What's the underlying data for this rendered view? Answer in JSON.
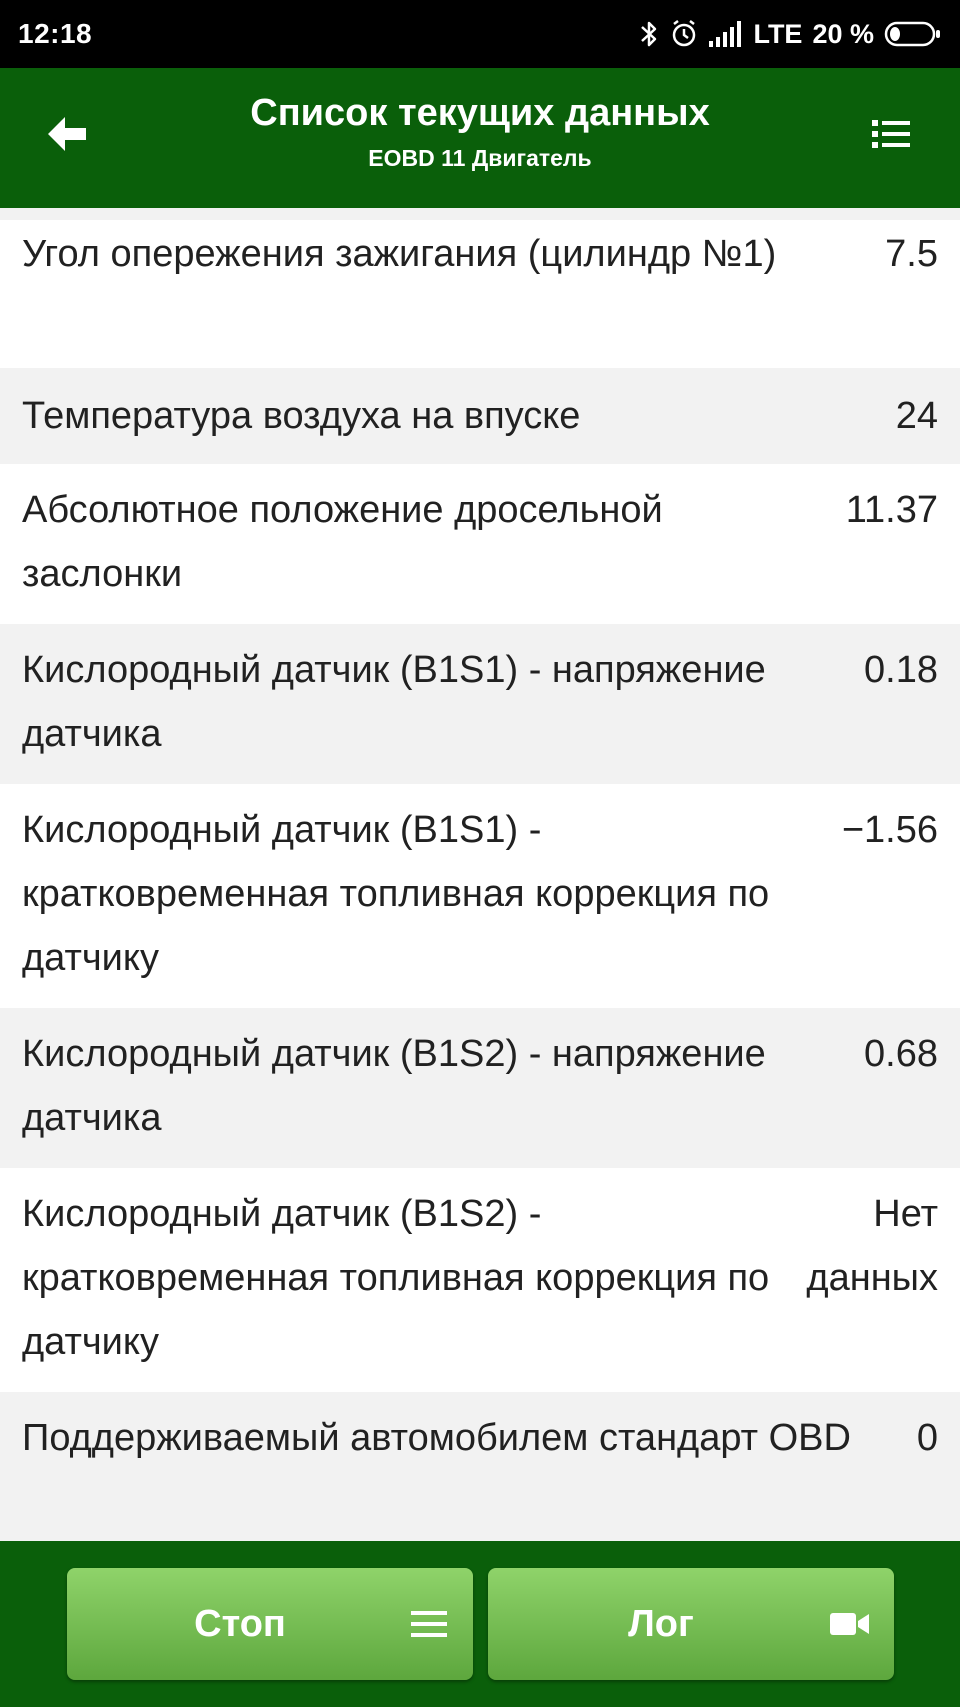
{
  "status_bar": {
    "time": "12:18",
    "network": "LTE",
    "battery": "20 %",
    "icons": [
      "bluetooth-icon",
      "alarm-icon",
      "signal-icon",
      "battery-icon"
    ]
  },
  "header": {
    "title": "Список текущих данных",
    "subtitle": "EOBD 11 Двигатель",
    "back_icon": "back-arrow-icon",
    "menu_icon": "list-menu-icon"
  },
  "rows": [
    {
      "label": "Угол опережения зажигания (цилиндр №1)",
      "value": "7.5"
    },
    {
      "label": "Температура воздуха на впуске",
      "value": "24"
    },
    {
      "label": "Абсолютное положение дросельной заслонки",
      "value": "11.37"
    },
    {
      "label": "Кислородный датчик (B1S1) - напряжение датчика",
      "value": "0.18"
    },
    {
      "label": "Кислородный датчик (B1S1) - кратковременная топливная коррекция по датчику",
      "value": "−1.56"
    },
    {
      "label": "Кислородный датчик (B1S2) - напряжение датчика",
      "value": "0.68"
    },
    {
      "label": "Кислородный датчик (B1S2) - кратковременная топливная коррекция по датчику",
      "value": "Нет\nданных"
    },
    {
      "label": "Поддерживаемый автомобилем стандарт OBD",
      "value": "0"
    }
  ],
  "buttons": {
    "stop": {
      "label": "Стоп",
      "icon": "list-icon"
    },
    "log": {
      "label": "Лог",
      "icon": "video-camera-icon"
    }
  },
  "colors": {
    "app_bar": "#0a5f0a",
    "button_top": "#8fd36a",
    "button_bottom": "#5da73d",
    "row_alt": "#f2f2f2"
  }
}
